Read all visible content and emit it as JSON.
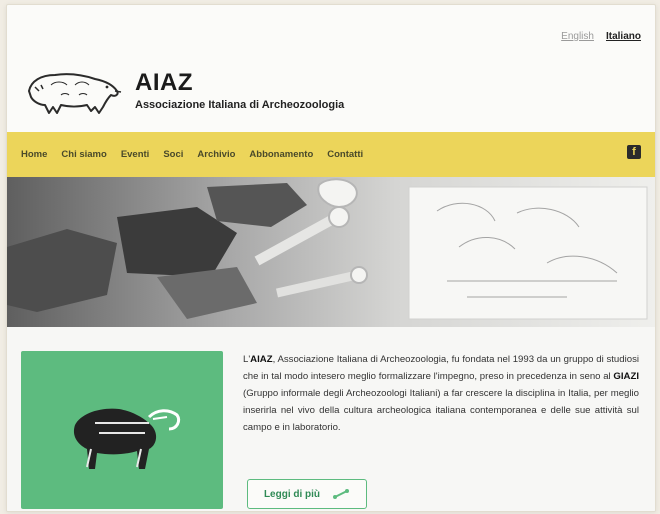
{
  "lang": {
    "english": "English",
    "italiano": "Italiano"
  },
  "brand": {
    "title": "AIAZ",
    "subtitle": "Associazione Italiana di Archeozoologia"
  },
  "nav": {
    "items": [
      "Home",
      "Chi siamo",
      "Eventi",
      "Soci",
      "Archivio",
      "Abbonamento",
      "Contatti"
    ]
  },
  "intro": {
    "t1": "L'",
    "b1": "AIAZ",
    "t2": ", Associazione Italiana di Archeozoologia, fu fondata nel 1993 da un gruppo di studiosi che in tal modo intesero meglio formalizzare l'impegno, preso in precedenza in seno al ",
    "b2": "GIAZI",
    "t3": " (Gruppo informale degli Archeozoologi Italiani) a far crescere la disciplina in Italia, per meglio inserirla nel vivo della cultura archeologica italiana contemporanea e delle sue attività sul campo e in laboratorio."
  },
  "button": {
    "label": "Leggi di più"
  },
  "colors": {
    "nav_bg": "#ecd55a",
    "accent_green": "#5dbb7f"
  },
  "icons": {
    "social": "facebook-icon",
    "button": "bone-icon"
  }
}
